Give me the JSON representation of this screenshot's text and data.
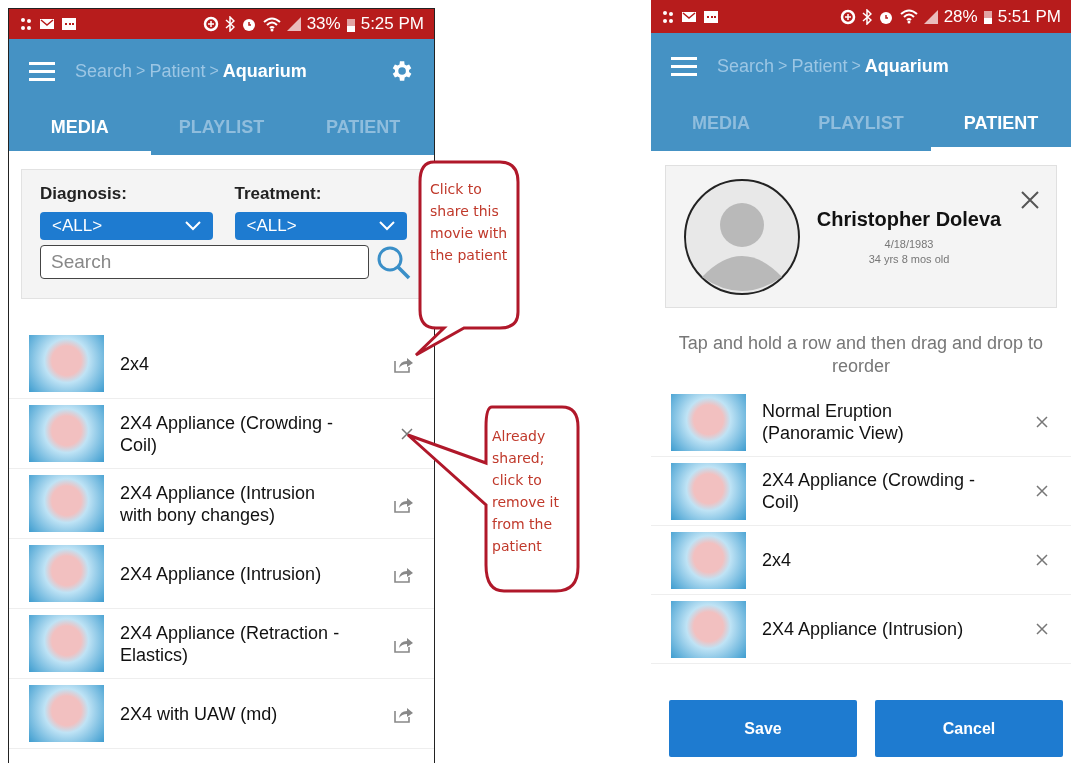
{
  "screens": [
    {
      "kind": "media",
      "status_bar": {
        "battery": "33%",
        "time": "5:25 PM"
      },
      "breadcrumb": {
        "separator": ">",
        "items": [
          {
            "label": "Search",
            "current": false
          },
          {
            "label": "Patient",
            "current": false
          },
          {
            "label": "Aquarium",
            "current": true
          }
        ]
      },
      "tabs": [
        {
          "label": "MEDIA",
          "selected": true
        },
        {
          "label": "PLAYLIST",
          "selected": false
        },
        {
          "label": "PATIENT",
          "selected": false
        }
      ],
      "filters": [
        {
          "label": "Diagnosis:",
          "value": "<ALL>"
        },
        {
          "label": "Treatment:",
          "value": "<ALL>"
        }
      ],
      "search": {
        "placeholder": "Search"
      },
      "items": [
        {
          "title": "2x4",
          "shared": false
        },
        {
          "title": "2X4 Appliance (Crowding - Coil)",
          "shared": true
        },
        {
          "title": "2X4 Appliance (Intrusion with bony changes)",
          "shared": false
        },
        {
          "title": "2X4 Appliance (Intrusion)",
          "shared": false
        },
        {
          "title": "2X4 Appliance (Retraction - Elastics)",
          "shared": false
        },
        {
          "title": "2X4 with UAW (md)",
          "shared": false
        }
      ]
    },
    {
      "kind": "patient",
      "status_bar": {
        "battery": "28%",
        "time": "5:51 PM"
      },
      "breadcrumb": {
        "separator": ">",
        "items": [
          {
            "label": "Search",
            "current": false
          },
          {
            "label": "Patient",
            "current": false
          },
          {
            "label": "Aquarium",
            "current": true
          }
        ]
      },
      "tabs": [
        {
          "label": "MEDIA",
          "selected": false
        },
        {
          "label": "PLAYLIST",
          "selected": false
        },
        {
          "label": "PATIENT",
          "selected": true
        }
      ],
      "patient": {
        "name": "Christopher Doleva",
        "birth_date": "4/18/1983",
        "age": "34 yrs 8 mos old"
      },
      "hint": "Tap and hold a row and then drag and drop to reorder",
      "items": [
        {
          "title": "Normal Eruption (Panoramic View)",
          "shared": true
        },
        {
          "title": "2X4 Appliance (Crowding - Coil)",
          "shared": true
        },
        {
          "title": "2x4",
          "shared": true
        },
        {
          "title": "2X4 Appliance (Intrusion)",
          "shared": true
        }
      ],
      "buttons": [
        "Save",
        "Cancel"
      ]
    }
  ],
  "callouts": [
    {
      "text": "Click to share this movie with the patient"
    },
    {
      "text": "Already shared; click to remove it from the patient"
    }
  ]
}
